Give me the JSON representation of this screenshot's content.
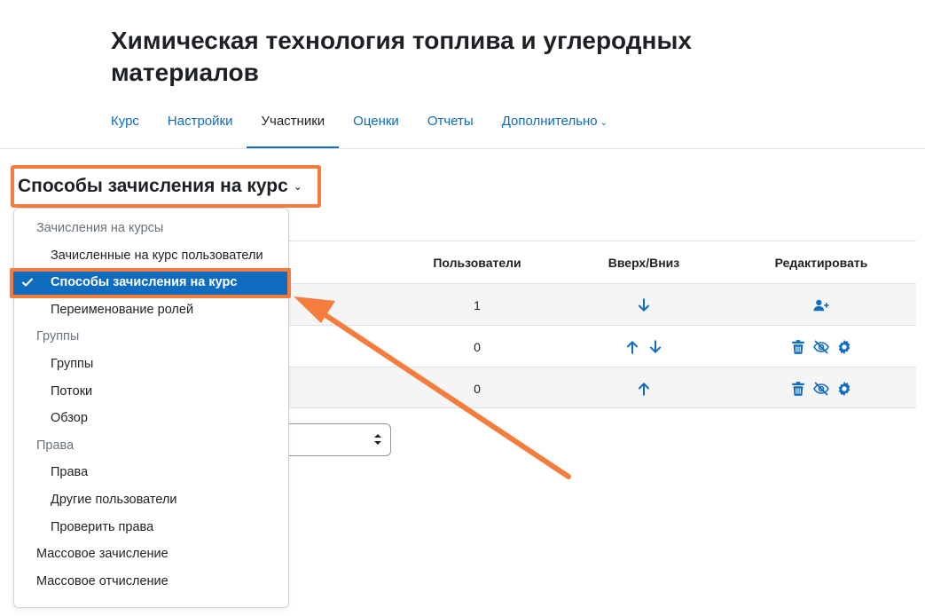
{
  "header": {
    "course_title": "Химическая технология топлива и углеродных материалов"
  },
  "nav": {
    "tabs": [
      {
        "label": "Курс"
      },
      {
        "label": "Настройки"
      },
      {
        "label": "Участники"
      },
      {
        "label": "Оценки"
      },
      {
        "label": "Отчеты"
      },
      {
        "label": "Дополнительно"
      }
    ]
  },
  "select": {
    "current": "Способы зачисления на курс"
  },
  "dropdown": {
    "header_enrol": "Зачисления на курсы",
    "enrolled_users": "Зачисленные на курс пользователи",
    "enrol_methods": "Способы зачисления на курс",
    "rename_roles": "Переименование ролей",
    "header_groups": "Группы",
    "groups": "Группы",
    "groupings": "Потоки",
    "overview": "Обзор",
    "header_perms": "Права",
    "permissions": "Права",
    "other_users": "Другие пользователи",
    "check_perms": "Проверить права",
    "bulk_enrol": "Массовое зачисление",
    "bulk_unenrol": "Массовое отчисление"
  },
  "table": {
    "headers": {
      "users": "Пользователи",
      "updown": "Вверх/Вниз",
      "edit": "Редактировать"
    },
    "rows": [
      {
        "users": "1"
      },
      {
        "users": "0"
      },
      {
        "users": "0"
      }
    ]
  },
  "colors": {
    "link": "#0f6cbf",
    "highlight": "#f47c3c",
    "selected_bg": "#0f6cbf"
  }
}
